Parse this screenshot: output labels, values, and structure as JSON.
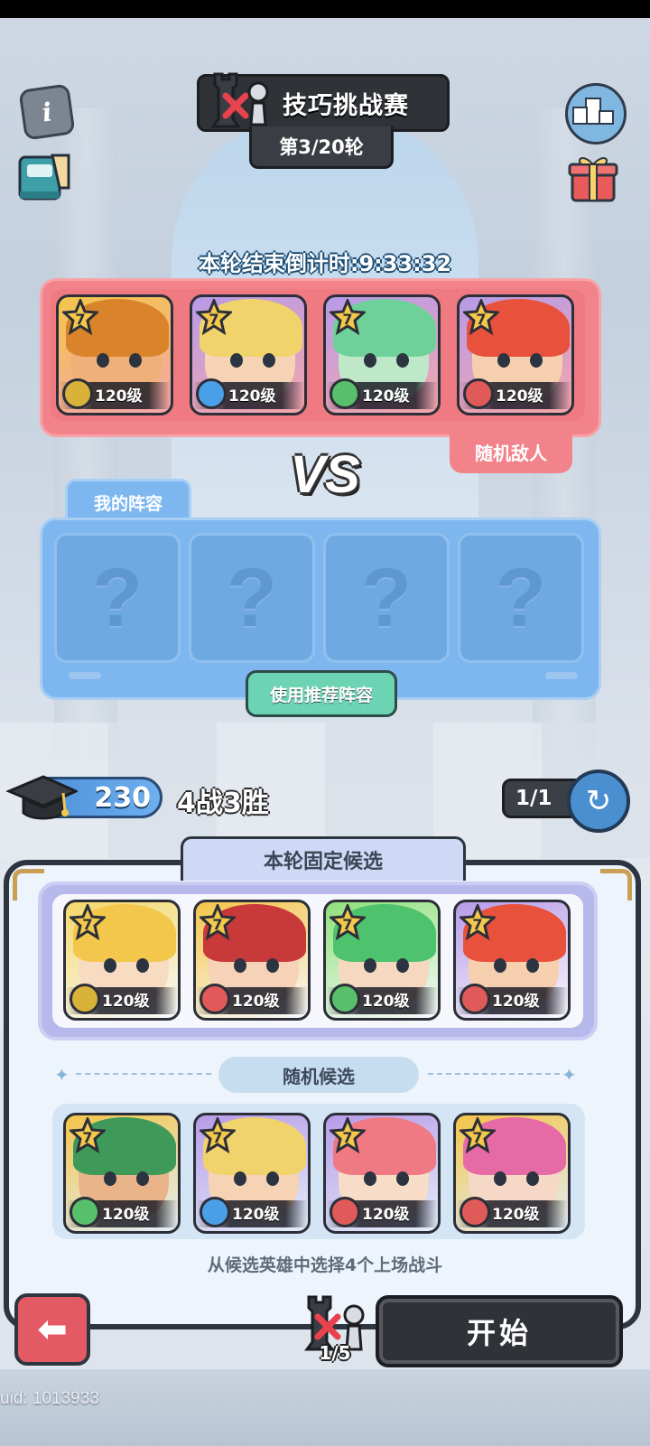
{
  "header": {
    "title": "技巧挑战赛",
    "round": "第3/20轮",
    "countdown": "本轮结束倒计时:9:33:32"
  },
  "enemy": {
    "label": "随机敌人",
    "heroes": [
      {
        "stars": "7",
        "level": "120级",
        "element": "earth",
        "theme": "#f3c54a",
        "hair": "#d9842a",
        "skin": "#f0b07a"
      },
      {
        "stars": "7",
        "level": "120级",
        "element": "water",
        "theme": "#b79be8",
        "hair": "#f1d36b",
        "skin": "#f6d3b5"
      },
      {
        "stars": "7",
        "level": "120级",
        "element": "wind",
        "theme": "#b79be8",
        "hair": "#6fd19a",
        "skin": "#bfe8c8"
      },
      {
        "stars": "7",
        "level": "120级",
        "element": "fire",
        "theme": "#b79be8",
        "hair": "#e8513c",
        "skin": "#f6cfae"
      }
    ]
  },
  "vs_text": "VS",
  "my_team": {
    "tab": "我的阵容",
    "slots": [
      "?",
      "?",
      "?",
      "?"
    ],
    "recommend_button": "使用推荐阵容"
  },
  "stats": {
    "score": "230",
    "record": "4战3胜",
    "refresh": "1/1"
  },
  "candidates": {
    "fixed_tab": "本轮固定候选",
    "fixed": [
      {
        "stars": "7",
        "level": "120级",
        "element": "earth",
        "theme": "#f3d86a",
        "hair": "#f3c74c",
        "skin": "#f8dcc2"
      },
      {
        "stars": "7",
        "level": "120级",
        "element": "fire",
        "theme": "#f3c54a",
        "hair": "#c8393a",
        "skin": "#f6d2b8"
      },
      {
        "stars": "7",
        "level": "120级",
        "element": "wind",
        "theme": "#8fe07a",
        "hair": "#4fc26e",
        "skin": "#f6d7bf"
      },
      {
        "stars": "7",
        "level": "120级",
        "element": "fire",
        "theme": "#b79be8",
        "hair": "#e8513c",
        "skin": "#f6cfae"
      }
    ],
    "random_label": "随机候选",
    "random": [
      {
        "stars": "7",
        "level": "120级",
        "element": "wind",
        "theme": "#f3c54a",
        "hair": "#3f9a5a",
        "skin": "#e9b48a"
      },
      {
        "stars": "7",
        "level": "120级",
        "element": "water",
        "theme": "#b79be8",
        "hair": "#f1d36b",
        "skin": "#f6d3b5"
      },
      {
        "stars": "7",
        "level": "120级",
        "element": "fire",
        "theme": "#b79be8",
        "hair": "#f07a84",
        "skin": "#f7dcc8"
      },
      {
        "stars": "7",
        "level": "120级",
        "element": "fire",
        "theme": "#f3c54a",
        "hair": "#e66aa6",
        "skin": "#f6d8c6"
      }
    ],
    "hint": "从候选英雄中选择4个上场战斗"
  },
  "footer": {
    "start_button": "开始",
    "battle_count": "1/5",
    "uid": "uid: 1013933"
  },
  "colors": {
    "earth": "#d9b23a",
    "water": "#4aa0e8",
    "wind": "#58c06a",
    "fire": "#e05a5a",
    "enemy_panel": "#f2838a",
    "team_panel": "#7eb7f0",
    "accent_green": "#6cd3b3"
  }
}
